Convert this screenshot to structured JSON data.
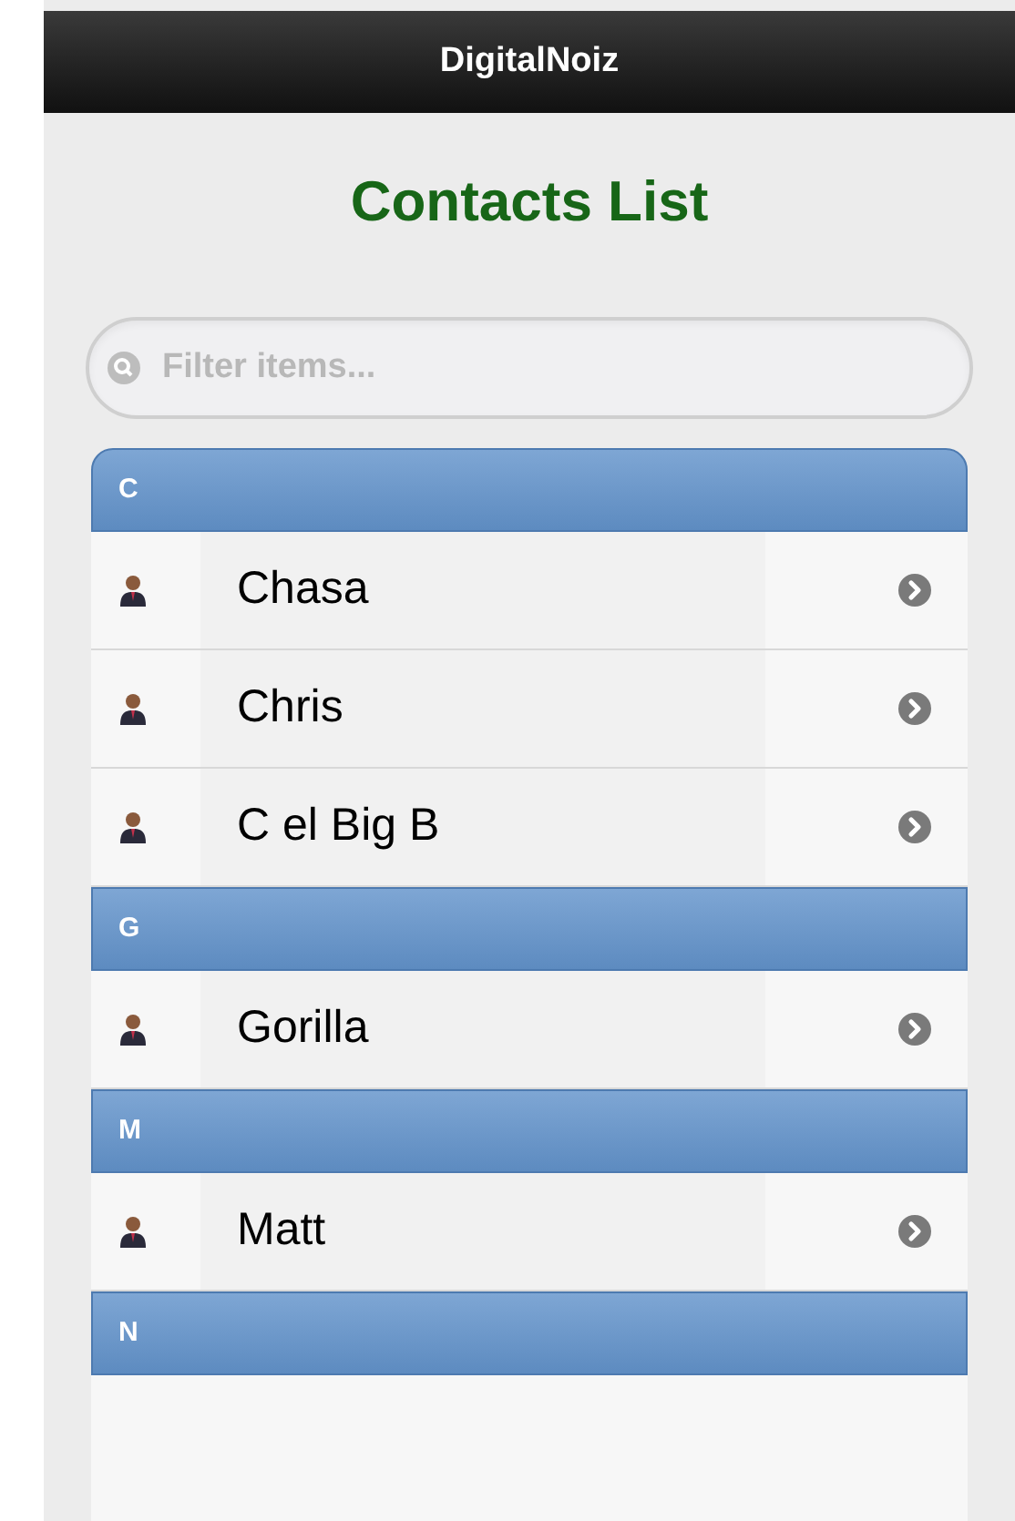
{
  "header": {
    "title": "DigitalNoiz"
  },
  "page": {
    "title": "Contacts List"
  },
  "filter": {
    "placeholder": "Filter items..."
  },
  "sections": [
    {
      "letter": "C",
      "contacts": [
        {
          "name": "Chasa"
        },
        {
          "name": "Chris"
        },
        {
          "name": "C el Big B"
        }
      ]
    },
    {
      "letter": "G",
      "contacts": [
        {
          "name": "Gorilla"
        }
      ]
    },
    {
      "letter": "M",
      "contacts": [
        {
          "name": "Matt"
        }
      ]
    },
    {
      "letter": "N"
    }
  ]
}
